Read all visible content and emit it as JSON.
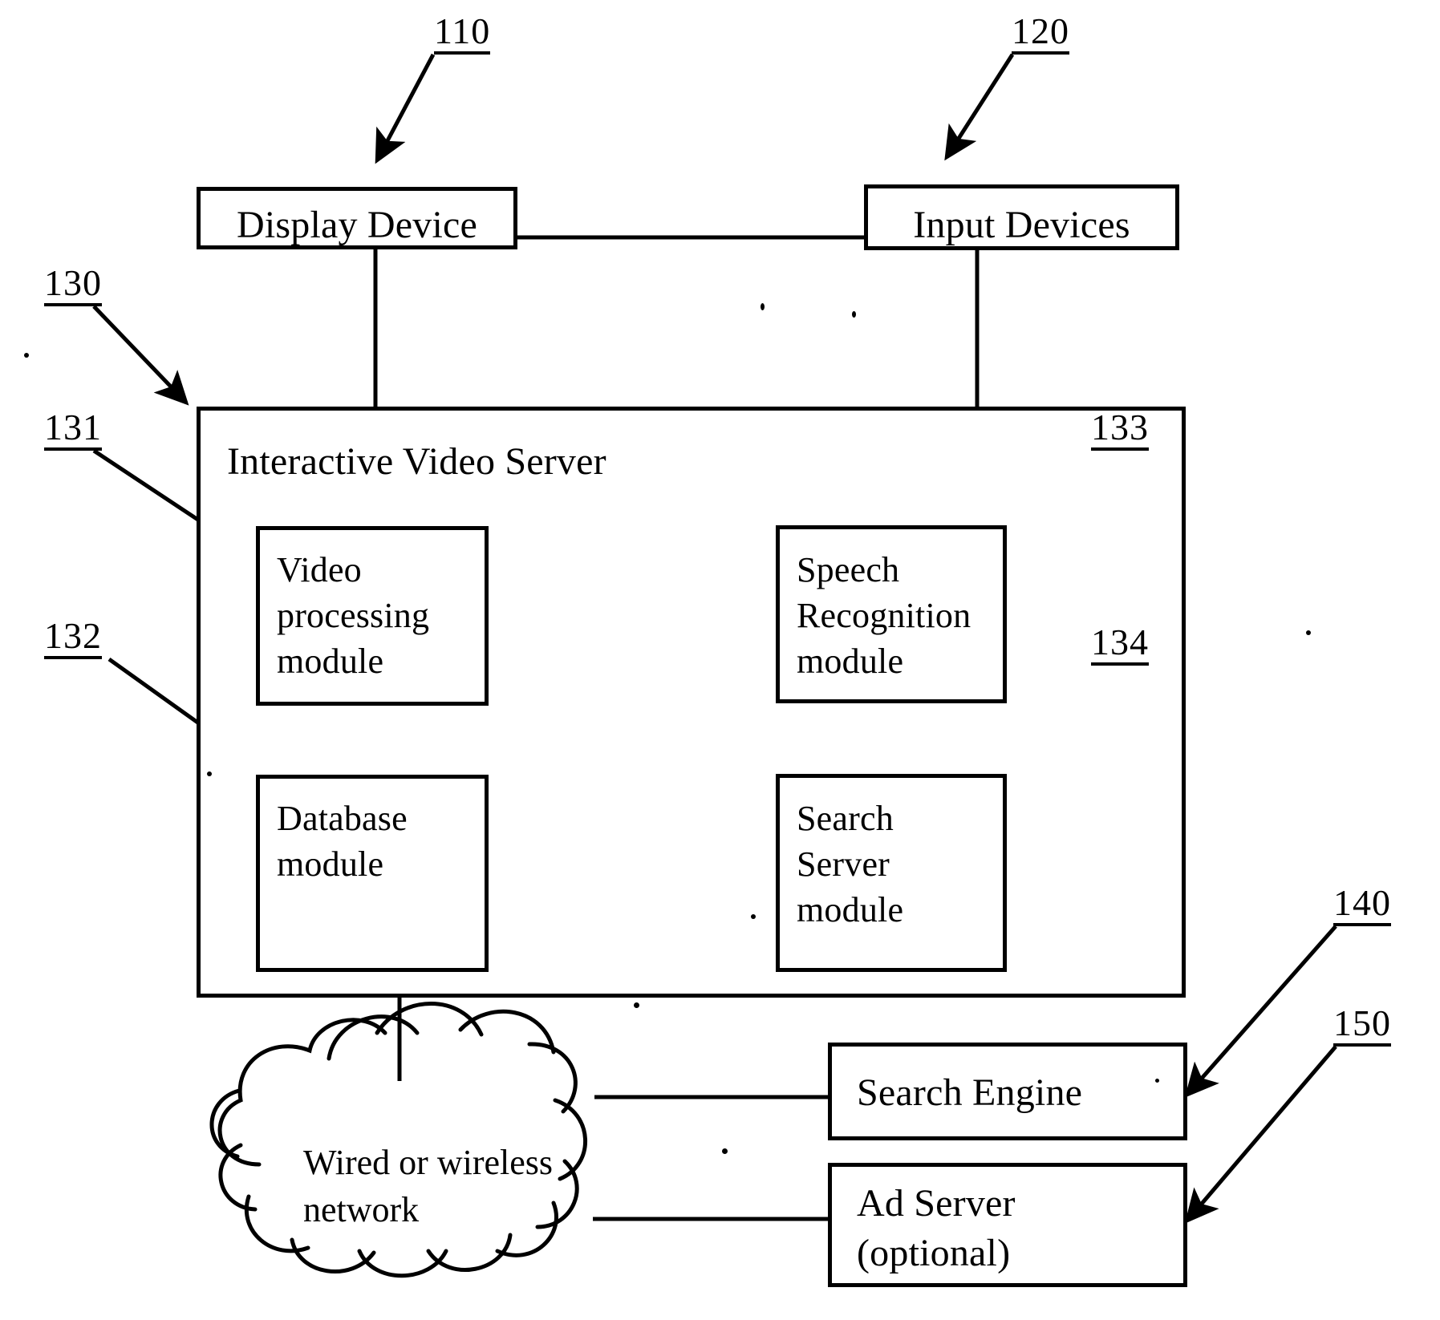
{
  "figure": {
    "type": "patent-block-diagram",
    "title": "Interactive video server system block diagram"
  },
  "boxes": [
    {
      "id": "display-device",
      "label": "Display Device",
      "ref": "110"
    },
    {
      "id": "input-devices",
      "label": "Input Devices",
      "ref": "120"
    },
    {
      "id": "interactive-video-server",
      "label": "Interactive Video Server",
      "ref": "130"
    },
    {
      "id": "video-processing-module",
      "label": "Video\nprocessing\nmodule",
      "ref": "131"
    },
    {
      "id": "database-module",
      "label": "Database\nmodule",
      "ref": "132"
    },
    {
      "id": "speech-recognition-module",
      "label": "Speech\nRecognition\nmodule",
      "ref": "133"
    },
    {
      "id": "search-server-module",
      "label": "Search\nServer\nmodule",
      "ref": "134"
    },
    {
      "id": "search-engine",
      "label": "Search Engine",
      "ref": "140"
    },
    {
      "id": "ad-server",
      "label": "Ad Server\n(optional)",
      "ref": "150"
    }
  ],
  "cloud": {
    "id": "network-cloud",
    "label": "Wired or wireless\nnetwork"
  },
  "refs": {
    "r110": "110",
    "r120": "120",
    "r130": "130",
    "r131": "131",
    "r132": "132",
    "r133": "133",
    "r134": "134",
    "r140": "140",
    "r150": "150"
  },
  "labels": {
    "display_device": "Display Device",
    "input_devices": "Input Devices",
    "interactive_video_server": "Interactive Video Server",
    "video_processing_module": "Video\nprocessing\nmodule",
    "database_module": "Database\nmodule",
    "speech_recognition_module": "Speech\nRecognition\nmodule",
    "search_server_module": "Search\nServer\nmodule",
    "search_engine": "Search Engine",
    "ad_server": "Ad Server\n(optional)",
    "network_cloud": "Wired or wireless\nnetwork"
  },
  "colors": {
    "stroke": "#000000",
    "background": "#ffffff"
  }
}
